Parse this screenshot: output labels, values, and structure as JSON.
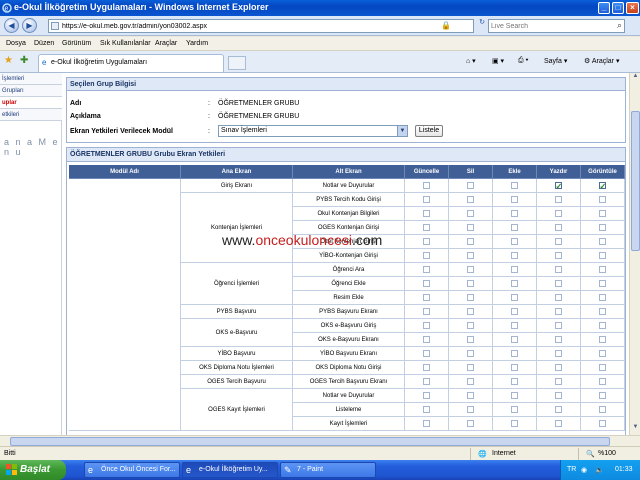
{
  "window": {
    "title": "e-Okul İlköğretim Uygulamaları - Windows Internet Explorer"
  },
  "addressbar": {
    "url": "https://e-okul.meb.gov.tr/admin/yon03002.aspx",
    "search_placeholder": "Live Search"
  },
  "menu": [
    "Dosya",
    "Düzen",
    "Görünüm",
    "Sık Kullanılanlar",
    "Araçlar",
    "Yardım"
  ],
  "tabs": {
    "active_label": "e-Okul İlköğretim Uygulamaları",
    "tools": {
      "page": "Sayfa",
      "tools": "Araçlar"
    }
  },
  "leftnav": {
    "items": [
      "İşlemleri",
      "Grupları",
      "uplar",
      "etkileri"
    ],
    "title": "a n a  M e n u"
  },
  "groupinfo": {
    "header": "Seçilen Grup Bilgisi",
    "name_label": "Adı",
    "name_value": "ÖĞRETMENLER GRUBU",
    "desc_label": "Açıklama",
    "desc_value": "ÖĞRETMENLER GRUBU",
    "module_label": "Ekran Yetkileri Verilecek Modül",
    "module_value": "Sınav İşlemleri",
    "list_button": "Listele",
    "colon": ":"
  },
  "permissions": {
    "header": "ÖĞRETMENLER GRUBU  Grubu Ekran Yetkileri",
    "columns": [
      "Modül Adı",
      "Ana Ekran",
      "Alt Ekran",
      "Güncelle",
      "Sil",
      "Ekle",
      "Yazdır",
      "Görüntüle"
    ],
    "rows": [
      {
        "ana": "Giriş Ekranı",
        "alt": "Notlar ve Duyurular",
        "checks": [
          false,
          false,
          false,
          true,
          true
        ]
      },
      {
        "ana": "",
        "alt": "PYBS Tercih Kodu Girişi",
        "checks": [
          false,
          false,
          false,
          false,
          false
        ]
      },
      {
        "ana": "",
        "alt": "Okul Kontenjan Bilgileri",
        "checks": [
          false,
          false,
          false,
          false,
          false
        ]
      },
      {
        "ana": "",
        "alt": "OGES Kontenjan Girişi",
        "checks": [
          false,
          false,
          false,
          false,
          false
        ]
      },
      {
        "ana": "",
        "alt": "Özel Kontenjan Girişi",
        "checks": [
          false,
          false,
          false,
          false,
          false
        ]
      },
      {
        "ana": "",
        "alt": "YİBO-Kontenjan Girişi",
        "checks": [
          false,
          false,
          false,
          false,
          false
        ]
      },
      {
        "ana": "",
        "alt": "Öğrenci Ara",
        "checks": [
          false,
          false,
          false,
          false,
          false
        ]
      },
      {
        "ana": "",
        "alt": "Öğrenci Ekle",
        "checks": [
          false,
          false,
          false,
          false,
          false
        ]
      },
      {
        "ana": "",
        "alt": "Resim Ekle",
        "checks": [
          false,
          false,
          false,
          false,
          false
        ]
      },
      {
        "ana": "PYBS Başvuru",
        "alt": "PYBS Başvuru Ekranı",
        "checks": [
          false,
          false,
          false,
          false,
          false
        ]
      },
      {
        "ana": "",
        "alt": "OKS e-Başvuru Giriş",
        "checks": [
          false,
          false,
          false,
          false,
          false
        ]
      },
      {
        "ana": "",
        "alt": "OKS e-Başvuru Ekranı",
        "checks": [
          false,
          false,
          false,
          false,
          false
        ]
      },
      {
        "ana": "YİBO Başvuru",
        "alt": "YİBO Başvuru Ekranı",
        "checks": [
          false,
          false,
          false,
          false,
          false
        ]
      },
      {
        "ana": "OKS Diploma Notu İşlemleri",
        "alt": "OKS Diploma Notu Girişi",
        "checks": [
          false,
          false,
          false,
          false,
          false
        ]
      },
      {
        "ana": "OGES Tercih Başvuru",
        "alt": "OGES Tercih Başvuru Ekranı",
        "checks": [
          false,
          false,
          false,
          false,
          false
        ]
      },
      {
        "ana": "",
        "alt": "Notlar ve Duyurular",
        "checks": [
          false,
          false,
          false,
          false,
          false
        ]
      },
      {
        "ana": "",
        "alt": "Listeleme",
        "checks": [
          false,
          false,
          false,
          false,
          false
        ]
      },
      {
        "ana": "",
        "alt": "Kayıt İşlemleri",
        "checks": [
          false,
          false,
          false,
          false,
          false
        ]
      }
    ],
    "merged": [
      {
        "label": "Kontenjan İşlemleri",
        "rows": 5
      },
      {
        "label": "Öğrenci İşlemleri",
        "rows": 3
      },
      {
        "label": "OKS e-Başvuru",
        "rows": 2
      },
      {
        "label": "OGES Kayıt İşlemleri",
        "rows": 3
      }
    ]
  },
  "watermark": {
    "prefix": "www.",
    "highlight": "onceokuloncesi",
    "suffix": ".com"
  },
  "statusbar": {
    "left": "Bitti",
    "zone": "Internet",
    "zoom": "%100"
  },
  "taskbar": {
    "start": "Başlat",
    "items": [
      "Önce Okul Öncesi For...",
      "e-Okul İlköğretim Uy...",
      "7 - Paint"
    ],
    "lang": "TR",
    "time": "01:33"
  },
  "colors": {
    "accent": "#3f5f96",
    "check": "#1f8a1f"
  }
}
